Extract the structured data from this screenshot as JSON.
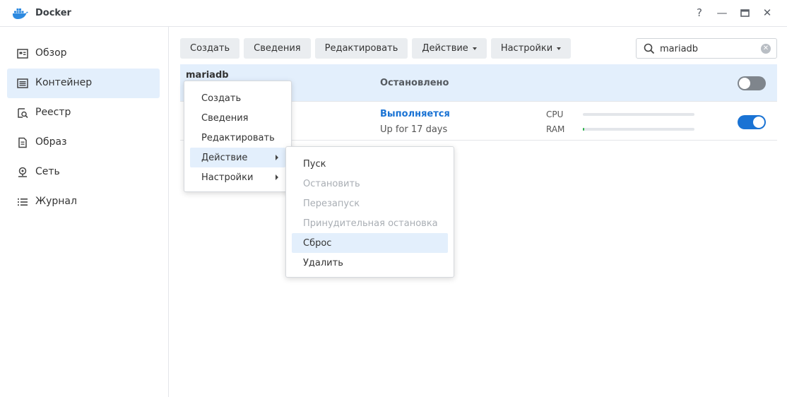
{
  "app": {
    "title": "Docker"
  },
  "window_controls": {
    "help": "?",
    "minimize": "—",
    "maximize": "▭",
    "close": "✕"
  },
  "sidebar": {
    "items": [
      {
        "label": "Обзор",
        "icon": "overview-icon",
        "active": false
      },
      {
        "label": "Контейнер",
        "icon": "container-icon",
        "active": true
      },
      {
        "label": "Реестр",
        "icon": "registry-icon",
        "active": false
      },
      {
        "label": "Образ",
        "icon": "image-icon",
        "active": false
      },
      {
        "label": "Сеть",
        "icon": "network-icon",
        "active": false
      },
      {
        "label": "Журнал",
        "icon": "log-icon",
        "active": false
      }
    ]
  },
  "toolbar": {
    "create": "Создать",
    "details": "Сведения",
    "edit": "Редактировать",
    "action": "Действие",
    "settings": "Настройки"
  },
  "search": {
    "value": "mariadb",
    "clear": "✕"
  },
  "containers": [
    {
      "name": "mariadb",
      "status": "Остановлено",
      "enabled": false
    },
    {
      "status": "Выполняется",
      "uptime": "Up for 17 days",
      "cpu_label": "CPU",
      "ram_label": "RAM",
      "cpu_usage": 0,
      "ram_usage": 0.01,
      "enabled": true
    }
  ],
  "context_menu": {
    "items": [
      "Создать",
      "Сведения",
      "Редактировать",
      "Действие",
      "Настройки"
    ]
  },
  "action_submenu": {
    "items": [
      {
        "label": "Пуск",
        "disabled": false
      },
      {
        "label": "Остановить",
        "disabled": true
      },
      {
        "label": "Перезапуск",
        "disabled": true
      },
      {
        "label": "Принудительная остановка",
        "disabled": true
      },
      {
        "label": "Сброс",
        "disabled": false,
        "highlighted": true
      },
      {
        "label": "Удалить",
        "disabled": false
      }
    ]
  },
  "colors": {
    "accent": "#1a73d4",
    "selected_bg": "#e3effc",
    "toggle_off": "#7f858c"
  }
}
